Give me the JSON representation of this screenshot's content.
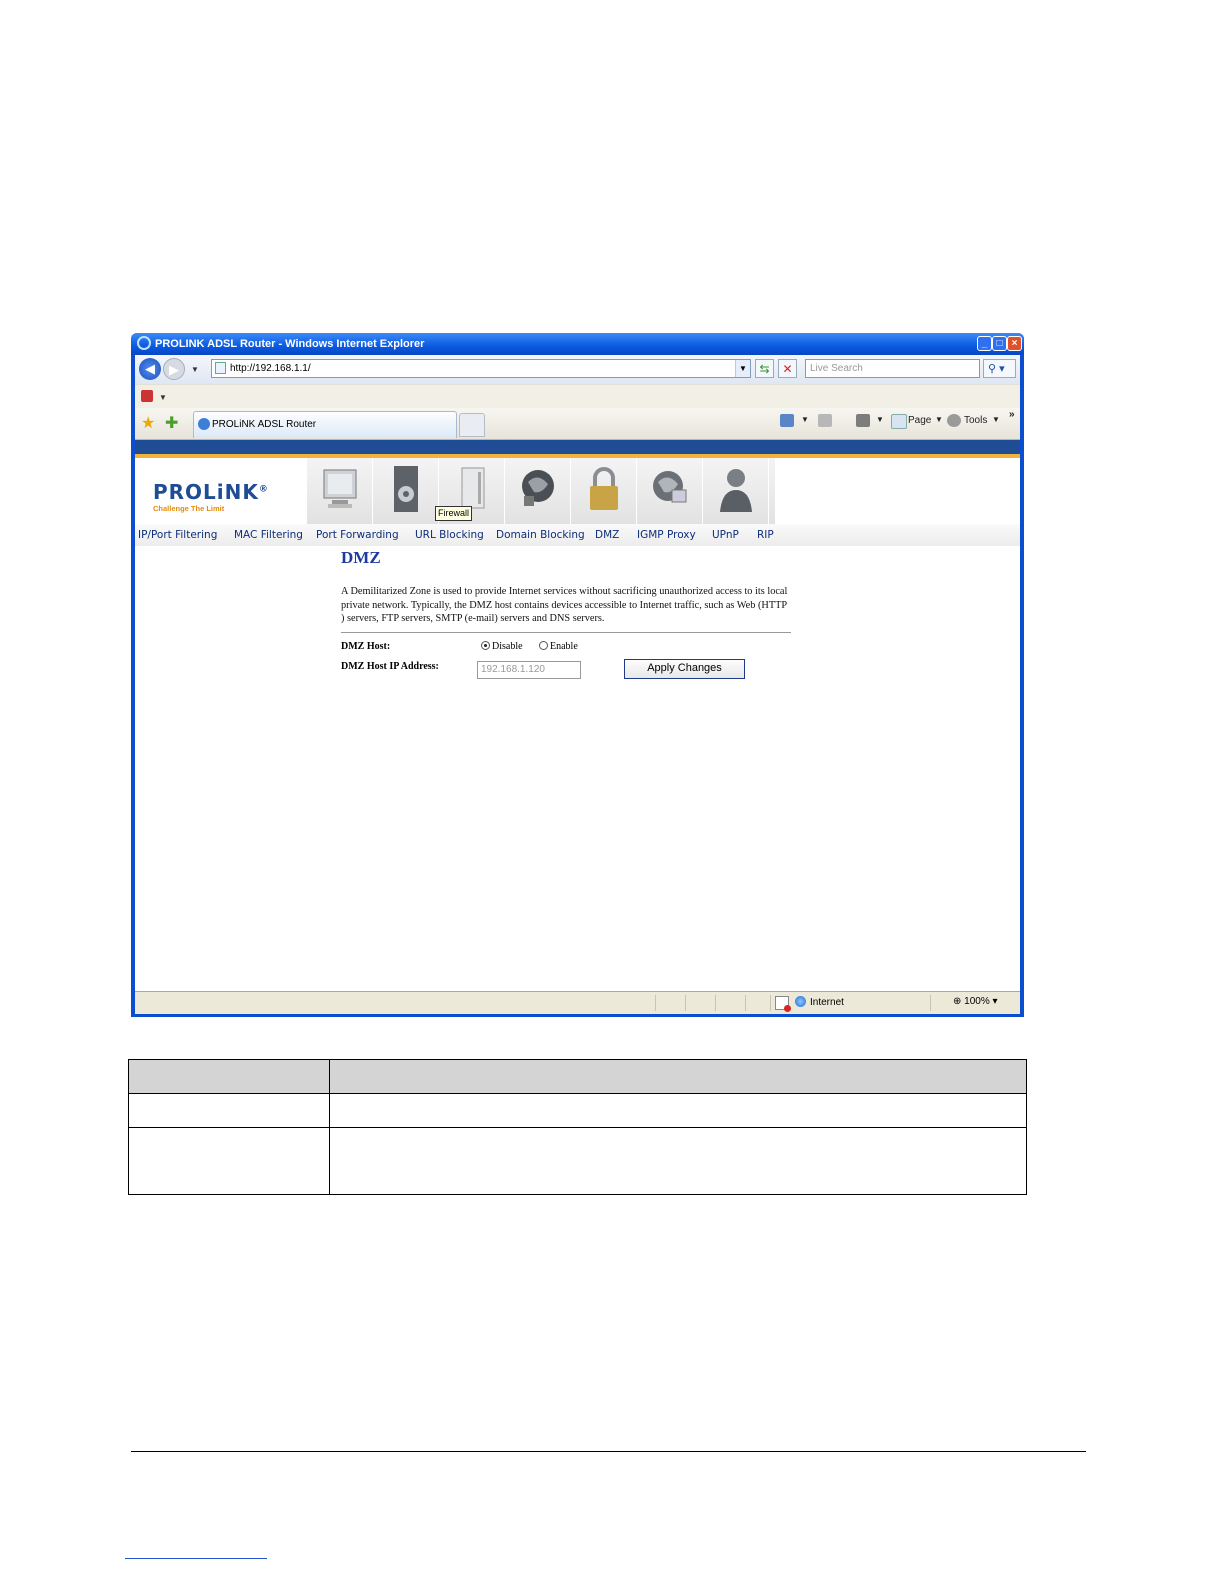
{
  "window": {
    "title": "PROLINK ADSL Router - Windows Internet Explorer",
    "controls": [
      "_",
      "□",
      "×"
    ]
  },
  "nav": {
    "back_icon": "back-arrow-icon",
    "forward_icon": "forward-arrow-icon",
    "address": "http://192.168.1.1/",
    "search_placeholder": "Live Search"
  },
  "tabs": [
    {
      "label": "PROLiNK ADSL Router"
    }
  ],
  "toolbar": {
    "page_label": "Page",
    "tools_label": "Tools",
    "more_label": "»"
  },
  "router": {
    "brand": "PROLiNK",
    "reg": "®",
    "tagline": "Challenge The Limit",
    "icons": [
      "status-monitor-icon",
      "setup-gear-icon",
      "advanced-server-icon",
      "internet-globe-icon",
      "firewall-lock-icon",
      "maintenance-globe-icon",
      "admin-user-icon"
    ],
    "tooltip": "Firewall",
    "menu": [
      "IP/Port Filtering",
      "MAC Filtering",
      "Port Forwarding",
      "URL Blocking",
      "Domain Blocking",
      "DMZ",
      "IGMP Proxy",
      "UPnP",
      "RIP"
    ]
  },
  "dmz": {
    "title": "DMZ",
    "description": "A Demilitarized Zone is used to provide Internet services without sacrificing unauthorized access to its local private network. Typically, the DMZ host contains devices accessible to Internet traffic, such as Web (HTTP ) servers, FTP servers, SMTP (e-mail) servers and DNS servers.",
    "host_label": "DMZ Host:",
    "disable_label": "Disable",
    "enable_label": "Enable",
    "selected": "Disable",
    "ip_label": "DMZ Host IP Address:",
    "ip_value": "192.168.1.120",
    "apply_label": "Apply Changes"
  },
  "status": {
    "zone": "Internet",
    "zoom": "100%"
  },
  "colors": {
    "accent": "#1e4c95",
    "stripe": "#f2b13b",
    "titlebar": "#0a5ae0"
  }
}
